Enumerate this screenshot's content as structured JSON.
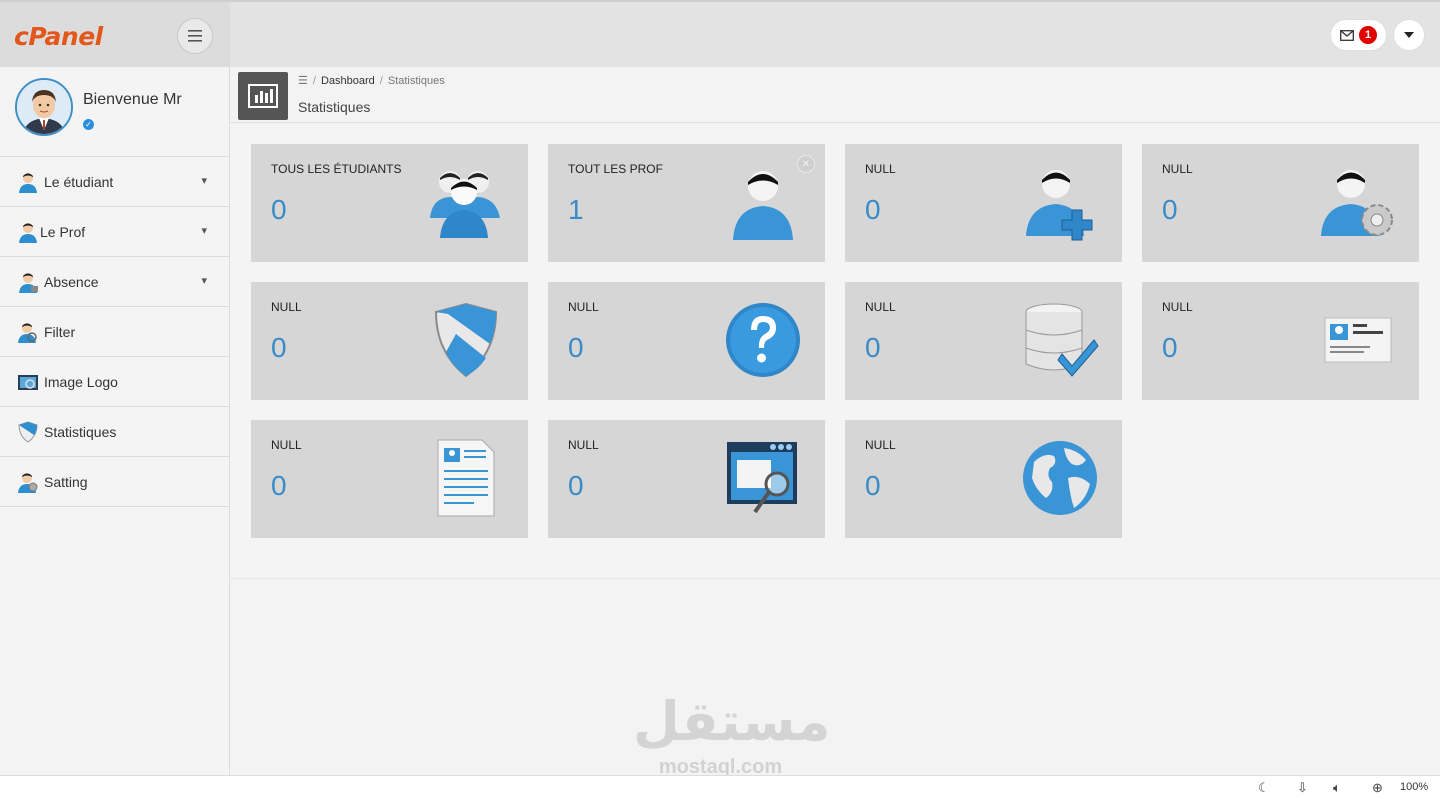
{
  "brand": {
    "logo_text": "cPanel"
  },
  "header": {
    "notification_count": "1"
  },
  "profile": {
    "welcome": "Bienvenue Mr"
  },
  "sidebar": {
    "items": [
      {
        "label": "Le étudiant",
        "icon": "student-icon"
      },
      {
        "label": "Le Prof",
        "icon": "teacher-icon"
      },
      {
        "label": "Absence",
        "icon": "absence-icon"
      },
      {
        "label": "Filter",
        "icon": "filter-icon"
      },
      {
        "label": "Image Logo",
        "icon": "image-logo-icon"
      },
      {
        "label": "Statistiques",
        "icon": "statistics-icon"
      },
      {
        "label": "Satting",
        "icon": "settings-icon"
      }
    ]
  },
  "breadcrumb": {
    "home": "Dashboard",
    "current": "Statistiques"
  },
  "page": {
    "title": "Statistiques"
  },
  "tiles": [
    {
      "label": "TOUS LES ÉTUDIANTS",
      "value": "0",
      "icon": "users-group-icon"
    },
    {
      "label": "TOUT LES PROF",
      "value": "1",
      "icon": "user-icon"
    },
    {
      "label": "NULL",
      "value": "0",
      "icon": "user-add-icon"
    },
    {
      "label": "NULL",
      "value": "0",
      "icon": "user-settings-icon"
    },
    {
      "label": "NULL",
      "value": "0",
      "icon": "shield-icon"
    },
    {
      "label": "NULL",
      "value": "0",
      "icon": "help-icon"
    },
    {
      "label": "NULL",
      "value": "0",
      "icon": "database-check-icon"
    },
    {
      "label": "NULL",
      "value": "0",
      "icon": "id-card-icon"
    },
    {
      "label": "NULL",
      "value": "0",
      "icon": "document-icon"
    },
    {
      "label": "NULL",
      "value": "0",
      "icon": "browser-search-icon"
    },
    {
      "label": "NULL",
      "value": "0",
      "icon": "globe-icon"
    }
  ],
  "watermark": {
    "arabic": "مستقل",
    "latin": "mostaql.com"
  },
  "statusbar": {
    "zoom": "100%"
  },
  "colors": {
    "accent": "#3a8bc7",
    "brand": "#e2571c",
    "tile_bg": "#d6d6d6",
    "badge": "#e00000"
  }
}
